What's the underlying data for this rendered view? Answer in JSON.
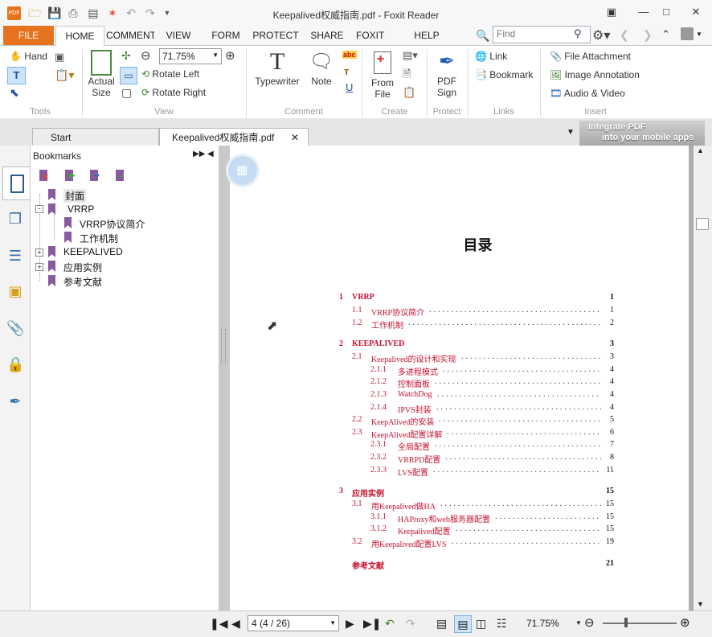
{
  "window": {
    "title": "Keepalived权威指南.pdf - Foxit Reader"
  },
  "ribbon_tabs": [
    "FILE",
    "HOME",
    "COMMENT",
    "VIEW",
    "FORM",
    "PROTECT",
    "SHARE",
    "FOXIT CLOUD",
    "HELP"
  ],
  "find": {
    "placeholder": "Find"
  },
  "tools": {
    "hand": "Hand",
    "label": "Tools"
  },
  "view": {
    "actual_size": "Actual Size",
    "zoom": "71.75%",
    "rotate_left": "Rotate Left",
    "rotate_right": "Rotate Right",
    "label": "View"
  },
  "comment": {
    "typewriter": "Typewriter",
    "note": "Note",
    "label": "Comment"
  },
  "create": {
    "from_file": "From File",
    "label": "Create"
  },
  "protect": {
    "pdf_sign": "PDF Sign",
    "label": "Protect"
  },
  "links": {
    "link": "Link",
    "bookmark": "Bookmark",
    "label": "Links"
  },
  "insert": {
    "file_attachment": "File Attachment",
    "image_annotation": "Image Annotation",
    "audio_video": "Audio & Video",
    "label": "Insert"
  },
  "doc_tabs": {
    "start": "Start",
    "current": "Keepalived权威指南.pdf"
  },
  "promo": {
    "line1": "Integrate PDF",
    "line2": "into your mobile apps"
  },
  "bookmarks": {
    "title": "Bookmarks",
    "items": [
      "封面",
      "VRRP",
      "VRRP协议简介",
      "工作机制",
      "KEEPALIVED",
      "应用实例",
      "参考文献"
    ]
  },
  "page": {
    "heading": "目录",
    "toc": [
      {
        "num": "1",
        "title": "VRRP",
        "page": "1"
      },
      {
        "num": "1.1",
        "title": "VRRP协议简介",
        "page": "1"
      },
      {
        "num": "1.2",
        "title": "工作机制",
        "page": "2"
      },
      {
        "num": "2",
        "title": "KEEPALIVED",
        "page": "3"
      },
      {
        "num": "2.1",
        "title": "Keepalived的设计和实现",
        "page": "3"
      },
      {
        "num": "2.1.1",
        "title": "多进程模式",
        "page": "4"
      },
      {
        "num": "2.1.2",
        "title": "控制面板",
        "page": "4"
      },
      {
        "num": "2.1.3",
        "title": "WatchDog",
        "page": "4"
      },
      {
        "num": "2.1.4",
        "title": "IPVS封装",
        "page": "4"
      },
      {
        "num": "2.2",
        "title": "KeepAlived的安装",
        "page": "5"
      },
      {
        "num": "2.3",
        "title": "KeepAlived配置详解",
        "page": "6"
      },
      {
        "num": "2.3.1",
        "title": "全局配置",
        "page": "7"
      },
      {
        "num": "2.3.2",
        "title": "VRRPD配置",
        "page": "8"
      },
      {
        "num": "2.3.3",
        "title": "LVS配置",
        "page": "11"
      },
      {
        "num": "3",
        "title": "应用实例",
        "page": "15"
      },
      {
        "num": "3.1",
        "title": "用Keepalived做HA",
        "page": "15"
      },
      {
        "num": "3.1.1",
        "title": "HAProxy和web服务器配置",
        "page": "15"
      },
      {
        "num": "3.1.2",
        "title": "Keepalived配置",
        "page": "15"
      },
      {
        "num": "3.2",
        "title": "用Keepalived配置LVS",
        "page": "19"
      },
      {
        "num": "",
        "title": "参考文献",
        "page": "21"
      }
    ]
  },
  "status": {
    "page_field": "4 (4 / 26)",
    "zoom": "71.75%"
  },
  "colors": {
    "accent": "#e8731e",
    "link_red": "#c8102e",
    "bookmark_purple": "#8a5aa0"
  }
}
